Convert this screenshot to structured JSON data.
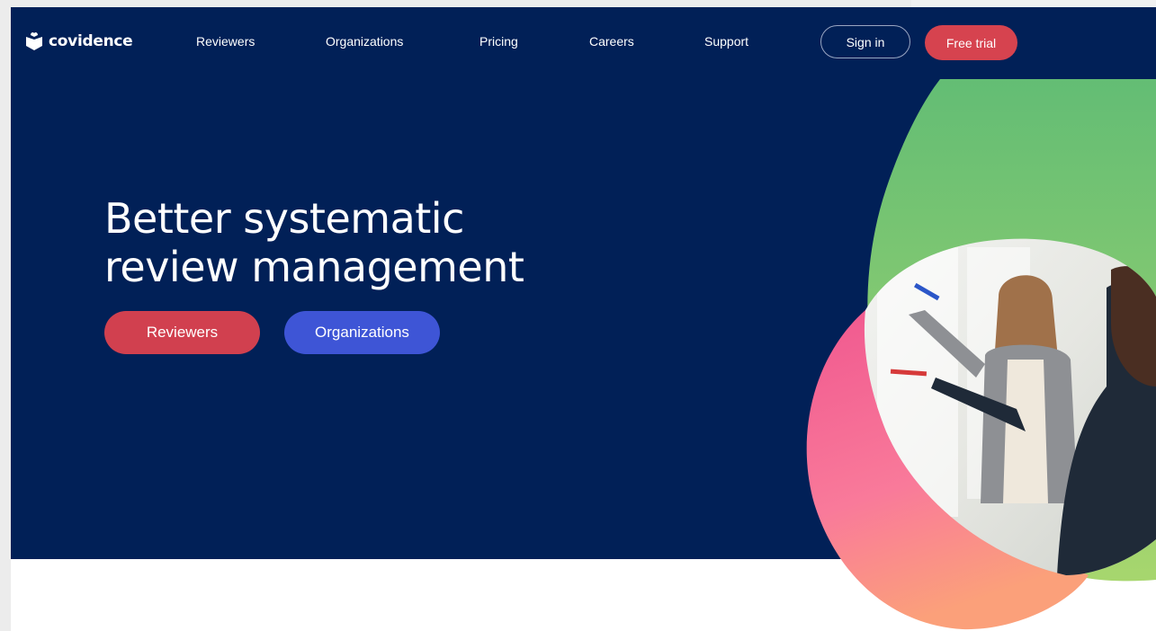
{
  "brand": {
    "name": "covidence"
  },
  "nav": {
    "links": [
      "Reviewers",
      "Organizations",
      "Pricing",
      "Careers",
      "Support"
    ],
    "sign_in": "Sign in",
    "free_trial": "Free trial"
  },
  "hero": {
    "title_line1": "Better systematic",
    "title_line2": "review management",
    "buttons": {
      "reviewers": "Reviewers",
      "organizations": "Organizations"
    }
  },
  "colors": {
    "hero_bg": "#012057",
    "primary_red": "#d6434f",
    "primary_blue": "#3e55d6",
    "green_accent": "#7cc96f",
    "pink_accent": "#f5689e"
  }
}
